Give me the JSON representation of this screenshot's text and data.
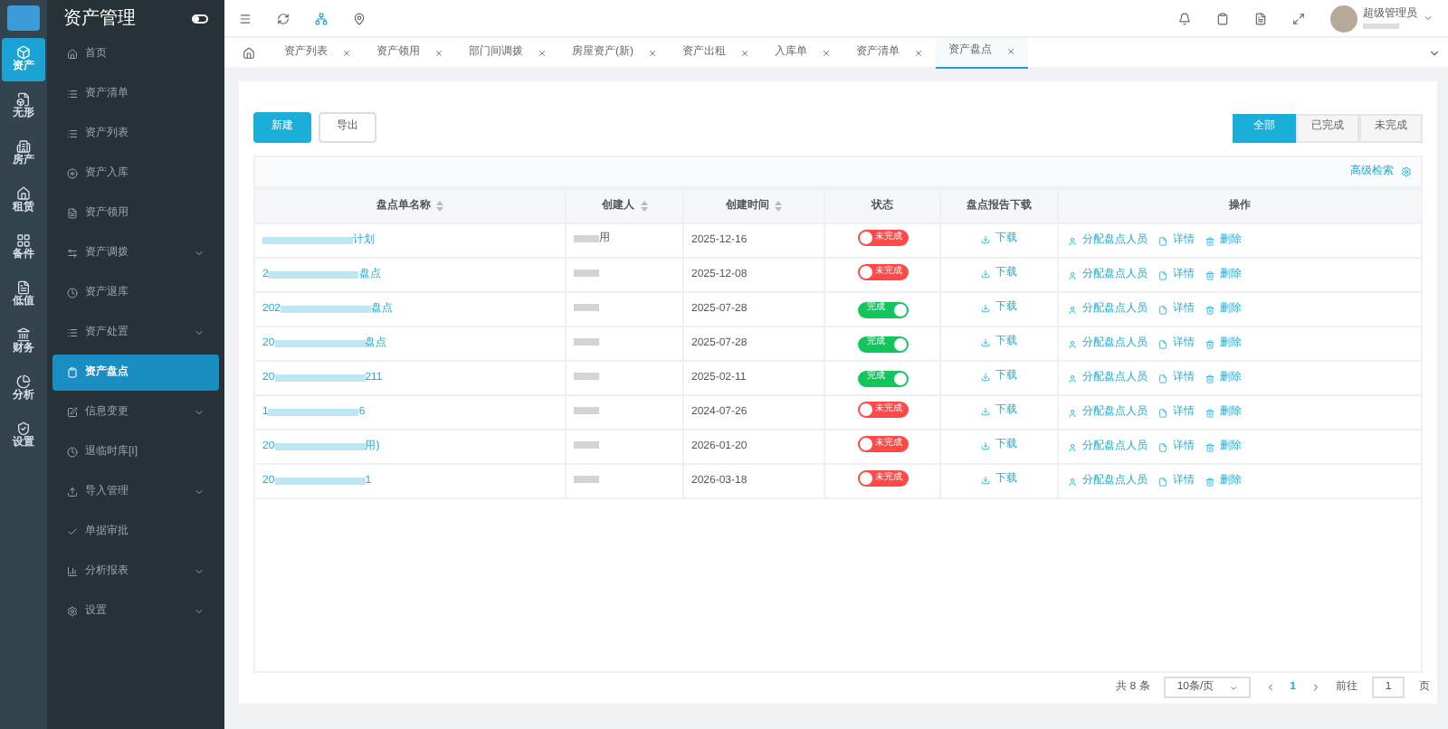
{
  "app": {
    "title": "资产管理"
  },
  "rail": [
    {
      "label": "资产",
      "selected": true
    },
    {
      "label": "无形",
      "selected": false
    },
    {
      "label": "房产",
      "selected": false
    },
    {
      "label": "租赁",
      "selected": false
    },
    {
      "label": "备件",
      "selected": false
    },
    {
      "label": "低值",
      "selected": false
    },
    {
      "label": "财务",
      "selected": false
    },
    {
      "label": "分析",
      "selected": false
    },
    {
      "label": "设置",
      "selected": false
    }
  ],
  "menu": [
    {
      "label": "首页",
      "expandable": false,
      "selected": false
    },
    {
      "label": "资产清单",
      "expandable": false,
      "selected": false
    },
    {
      "label": "资产列表",
      "expandable": false,
      "selected": false
    },
    {
      "label": "资产入库",
      "expandable": false,
      "selected": false
    },
    {
      "label": "资产领用",
      "expandable": false,
      "selected": false
    },
    {
      "label": "资产调拨",
      "expandable": true,
      "selected": false
    },
    {
      "label": "资产退库",
      "expandable": false,
      "selected": false
    },
    {
      "label": "资产处置",
      "expandable": true,
      "selected": false
    },
    {
      "label": "资产盘点",
      "expandable": false,
      "selected": true
    },
    {
      "label": "信息变更",
      "expandable": true,
      "selected": false
    },
    {
      "label": "退临时库[I]",
      "expandable": false,
      "selected": false
    },
    {
      "label": "导入管理",
      "expandable": true,
      "selected": false
    },
    {
      "label": "单据审批",
      "expandable": false,
      "selected": false
    },
    {
      "label": "分析报表",
      "expandable": true,
      "selected": false
    },
    {
      "label": "设置",
      "expandable": true,
      "selected": false
    }
  ],
  "user": {
    "name": "超级管理员"
  },
  "tabs": [
    {
      "label": "资产列表",
      "selected": false
    },
    {
      "label": "资产领用",
      "selected": false
    },
    {
      "label": "部门间调拨",
      "selected": false
    },
    {
      "label": "房屋资产(新)",
      "selected": false
    },
    {
      "label": "资产出租",
      "selected": false
    },
    {
      "label": "入库单",
      "selected": false
    },
    {
      "label": "资产清单",
      "selected": false
    },
    {
      "label": "资产盘点",
      "selected": true
    }
  ],
  "buttons": {
    "new": "新建",
    "export": "导出"
  },
  "filters": [
    {
      "label": "全部",
      "selected": true
    },
    {
      "label": "已完成",
      "selected": false
    },
    {
      "label": "未完成",
      "selected": false
    }
  ],
  "advanced_search": "高级检索",
  "table": {
    "columns": [
      {
        "label": "盘点单名称",
        "sortable": true
      },
      {
        "label": "创建人",
        "sortable": true
      },
      {
        "label": "创建时间",
        "sortable": true
      },
      {
        "label": "状态",
        "sortable": false
      },
      {
        "label": "盘点报告下载",
        "sortable": false
      },
      {
        "label": "操作",
        "sortable": false
      }
    ],
    "rows": [
      {
        "name_prefix": "",
        "name_suffix": "计划",
        "creator": "用",
        "date": "2025-12-16",
        "done": false,
        "status": "未完成",
        "download": "下载",
        "actions": [
          "分配盘点人员",
          "详情",
          "删除"
        ]
      },
      {
        "name_prefix": "2",
        "name_suffix": "盘点",
        "creator": "",
        "date": "2025-12-08",
        "done": false,
        "status": "未完成",
        "download": "下载",
        "actions": [
          "分配盘点人员",
          "详情",
          "删除"
        ]
      },
      {
        "name_prefix": "202",
        "name_suffix": "盘点",
        "creator": "",
        "date": "2025-07-28",
        "done": true,
        "status": "完成",
        "download": "下载",
        "actions": [
          "分配盘点人员",
          "详情",
          "删除"
        ]
      },
      {
        "name_prefix": "20",
        "name_suffix": "盘点",
        "creator": "",
        "date": "2025-07-28",
        "done": true,
        "status": "完成",
        "download": "下载",
        "actions": [
          "分配盘点人员",
          "详情",
          "删除"
        ]
      },
      {
        "name_prefix": "20",
        "name_suffix": "211",
        "creator": "",
        "date": "2025-02-11",
        "done": true,
        "status": "完成",
        "download": "下载",
        "actions": [
          "分配盘点人员",
          "详情",
          "删除"
        ]
      },
      {
        "name_prefix": "1",
        "name_suffix": "6",
        "creator": "",
        "date": "2024-07-26",
        "done": false,
        "status": "未完成",
        "download": "下载",
        "actions": [
          "分配盘点人员",
          "详情",
          "删除"
        ]
      },
      {
        "name_prefix": "20",
        "name_suffix": "用)",
        "creator": "",
        "date": "2026-01-20",
        "done": false,
        "status": "未完成",
        "download": "下载",
        "actions": [
          "分配盘点人员",
          "详情",
          "删除"
        ]
      },
      {
        "name_prefix": "20",
        "name_suffix": "1",
        "creator": "",
        "date": "2026-03-18",
        "done": false,
        "status": "未完成",
        "download": "下载",
        "actions": [
          "分配盘点人员",
          "详情",
          "删除"
        ]
      }
    ]
  },
  "pagination": {
    "total": "共 8 条",
    "page_size": "10条/页",
    "page": "1",
    "goto_label": "前往",
    "goto_value": "1",
    "goto_suffix": "页"
  }
}
